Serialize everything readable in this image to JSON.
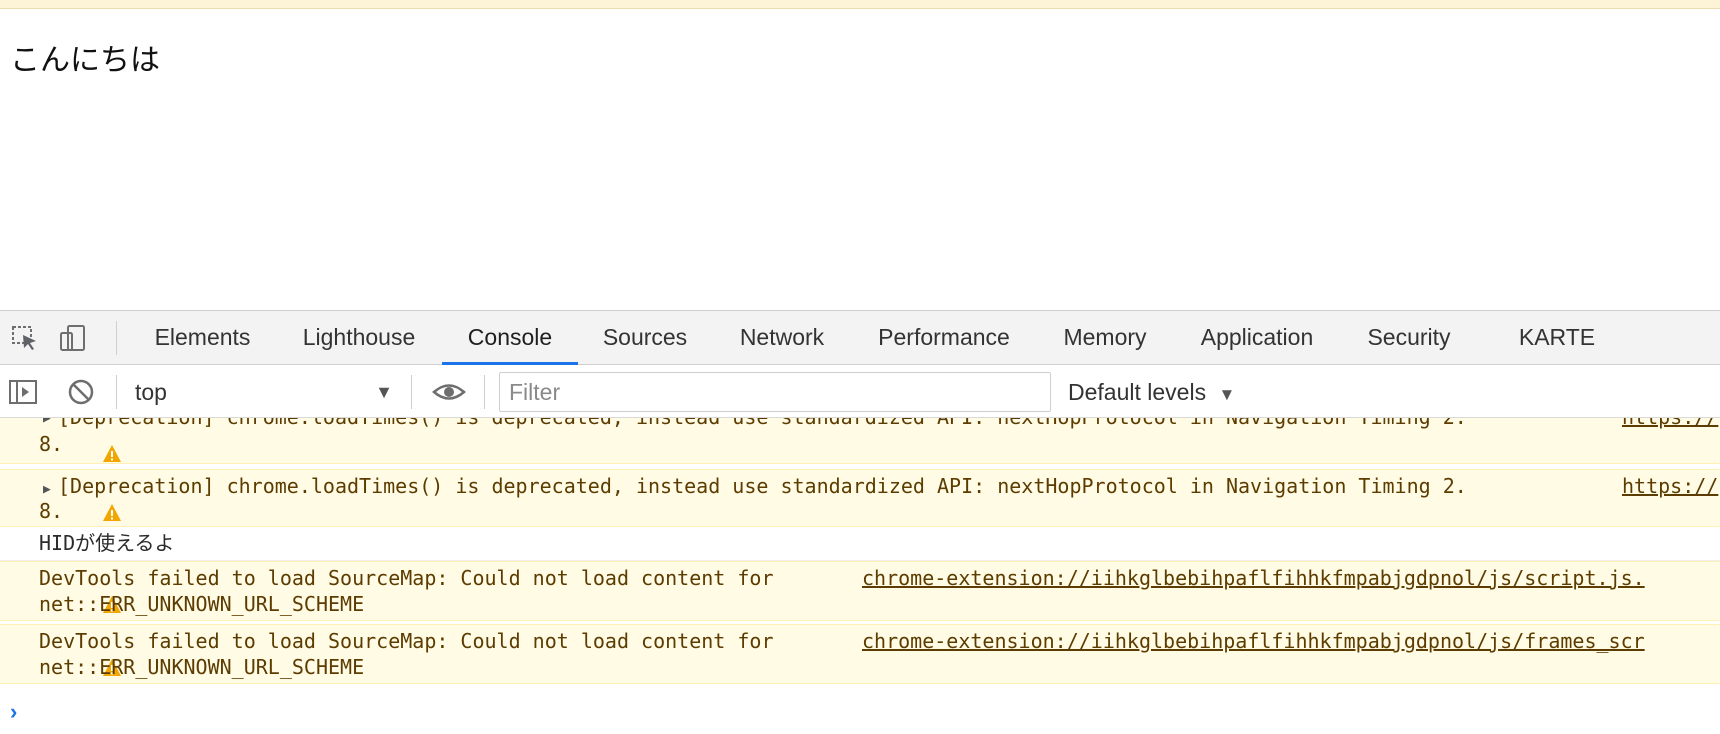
{
  "page": {
    "text": "こんにちは"
  },
  "devtools": {
    "tabs": [
      {
        "label": "Elements"
      },
      {
        "label": "Lighthouse"
      },
      {
        "label": "Console"
      },
      {
        "label": "Sources"
      },
      {
        "label": "Network"
      },
      {
        "label": "Performance"
      },
      {
        "label": "Memory"
      },
      {
        "label": "Application"
      },
      {
        "label": "Security"
      },
      {
        "label": "KARTE"
      }
    ],
    "active_tab": "Console",
    "icons": {
      "inspect": "inspect-element-icon",
      "device": "device-toolbar-icon",
      "sidebar": "sidebar-toggle-icon",
      "clear": "clear-console-icon",
      "eye": "live-expression-icon",
      "warning": "warning-icon"
    },
    "colors": {
      "accent": "#1a73e8",
      "warning_bg": "#fffbe5",
      "warning_text": "#5c3c00",
      "warning_icon": "#f2a600"
    }
  },
  "console_toolbar": {
    "context": "top",
    "filter_placeholder": "Filter",
    "levels": "Default levels"
  },
  "console": {
    "messages": [
      {
        "line1": "[Deprecation] chrome.loadTimes() is deprecated, instead use standardized API: nextHopProtocol in Navigation Timing 2.",
        "link": "https://",
        "line2": "8."
      },
      {
        "line1": "[Deprecation] chrome.loadTimes() is deprecated, instead use standardized API: nextHopProtocol in Navigation Timing 2.",
        "link": "https://",
        "line2": "8."
      },
      {
        "text": "HIDが使えるよ"
      },
      {
        "prefix": "DevTools failed to load SourceMap: Could not load content for",
        "link": "chrome-extension://iihkglbebihpaflfihhkfmpabjgdpnol/js/script.js.",
        "line2": "net::ERR_UNKNOWN_URL_SCHEME"
      },
      {
        "prefix": "DevTools failed to load SourceMap: Could not load content for",
        "link": "chrome-extension://iihkglbebihpaflfihhkfmpabjgdpnol/js/frames_scr",
        "line2": "net::ERR_UNKNOWN_URL_SCHEME"
      }
    ],
    "prompt": "›"
  }
}
